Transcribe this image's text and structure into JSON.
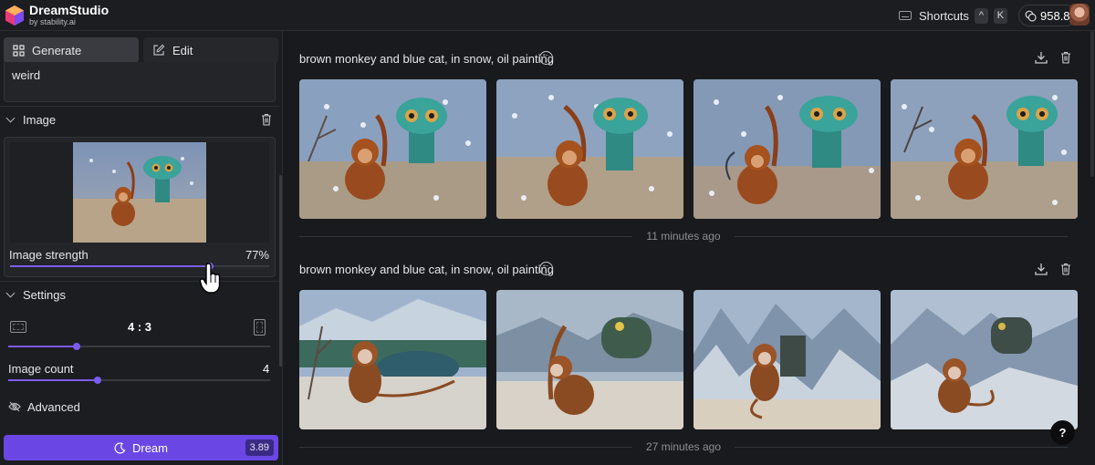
{
  "app": {
    "name": "DreamStudio",
    "byline": "by stability.ai"
  },
  "header": {
    "shortcuts_label": "Shortcuts",
    "shortcut_keys": [
      "^",
      "K"
    ],
    "credits": "958.8"
  },
  "sidebar": {
    "tabs": [
      {
        "label": "Generate",
        "icon": "grid-icon",
        "active": true
      },
      {
        "label": "Edit",
        "icon": "edit-icon",
        "active": false
      }
    ],
    "prompt_text": "weird",
    "image_section": {
      "title": "Image",
      "strength_label": "Image strength",
      "strength_value": "77%",
      "strength_fraction": 0.77
    },
    "settings_section": {
      "title": "Settings",
      "aspect_ratio": "4 : 3",
      "aspect_fraction": 0.26,
      "image_count_label": "Image count",
      "image_count": "4",
      "image_count_fraction": 0.34,
      "advanced_label": "Advanced"
    },
    "dream_button": {
      "label": "Dream",
      "cost": "3.89"
    }
  },
  "gallery": {
    "groups": [
      {
        "prompt": "brown monkey and blue cat, in snow, oil painting",
        "timestamp": "11 minutes ago",
        "images": [
          "monkey-and-blue-cat-1",
          "monkey-and-blue-cat-2",
          "monkey-and-blue-cat-3",
          "monkey-and-blue-cat-4"
        ]
      },
      {
        "prompt": "brown monkey and blue cat, in snow, oil painting",
        "timestamp": "27 minutes ago",
        "images": [
          "monkey-snow-landscape-1",
          "monkey-and-cat-on-rocks-2",
          "monkey-in-mountains-3",
          "monkey-and-cat-on-rocks-4"
        ]
      }
    ]
  },
  "help_label": "?",
  "colors": {
    "background": "#191a1d",
    "panel": "#1c1d20",
    "accent": "#6a47e4",
    "slider": "#7c5cf0"
  }
}
